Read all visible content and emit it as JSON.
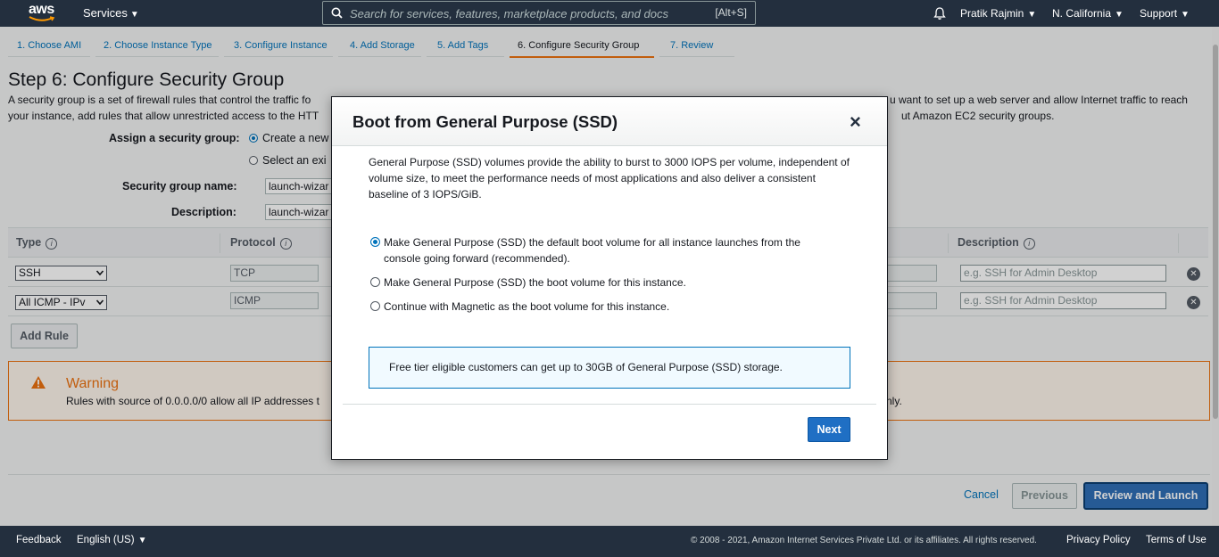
{
  "nav": {
    "logo": "aws",
    "services": "Services",
    "search_placeholder": "Search for services, features, marketplace products, and docs",
    "search_shortcut": "[Alt+S]",
    "user": "Pratik Rajmin",
    "region": "N. California",
    "support": "Support"
  },
  "steps": [
    {
      "label": "1. Choose AMI"
    },
    {
      "label": "2. Choose Instance Type"
    },
    {
      "label": "3. Configure Instance"
    },
    {
      "label": "4. Add Storage"
    },
    {
      "label": "5. Add Tags"
    },
    {
      "label": "6. Configure Security Group",
      "active": true
    },
    {
      "label": "7. Review"
    }
  ],
  "page": {
    "title": "Step 6: Configure Security Group",
    "desc_left1": "A security group is a set of firewall rules that control the traffic fo",
    "desc_right1": "u want to set up a web server and allow Internet traffic to reach",
    "desc_left2": "your instance, add rules that allow unrestricted access to the HTT",
    "desc_right2": "ut Amazon EC2 security groups.",
    "assign_label": "Assign a security group:",
    "create_new": "Create a new",
    "select_existing": "Select an exi",
    "sg_name_label": "Security group name:",
    "sg_name_value": "launch-wizar",
    "desc_label": "Description:",
    "desc_value": "launch-wizar"
  },
  "table": {
    "headers": {
      "type": "Type",
      "protocol": "Protocol",
      "description": "Description"
    },
    "info": "i",
    "rows": [
      {
        "type": "SSH",
        "protocol": "TCP",
        "desc_placeholder": "e.g. SSH for Admin Desktop"
      },
      {
        "type": "All ICMP - IPv",
        "protocol": "ICMP",
        "desc_placeholder": "e.g. SSH for Admin Desktop"
      }
    ],
    "add_rule": "Add Rule"
  },
  "warning": {
    "title": "Warning",
    "text_left": "Rules with source of 0.0.0.0/0 allow all IP addresses t",
    "text_right": "nly."
  },
  "actions": {
    "cancel": "Cancel",
    "previous": "Previous",
    "review": "Review and Launch"
  },
  "footer": {
    "feedback": "Feedback",
    "language": "English (US)",
    "copyright": "© 2008 - 2021, Amazon Internet Services Private Ltd. or its affiliates. All rights reserved.",
    "privacy": "Privacy Policy",
    "terms": "Terms of Use"
  },
  "modal": {
    "title": "Boot from General Purpose (SSD)",
    "close": "×",
    "text": "General Purpose (SSD) volumes provide the ability to burst to 3000 IOPS per volume, independent of volume size, to meet the performance needs of most applications and also deliver a consistent baseline of 3 IOPS/GiB.",
    "options": [
      {
        "label": "Make General Purpose (SSD) the default boot volume for all instance launches from the console going forward (recommended).",
        "selected": true
      },
      {
        "label": "Make General Purpose (SSD) the boot volume for this instance.",
        "selected": false
      },
      {
        "label": "Continue with Magnetic as the boot volume for this instance.",
        "selected": false
      }
    ],
    "info": "Free tier eligible customers can get up to 30GB of General Purpose (SSD) storage.",
    "next": "Next"
  },
  "colors": {
    "nav_bg": "#232f3e",
    "accent": "#ec7211",
    "link": "#0073bb",
    "primary_button": "#1f6fc4"
  }
}
